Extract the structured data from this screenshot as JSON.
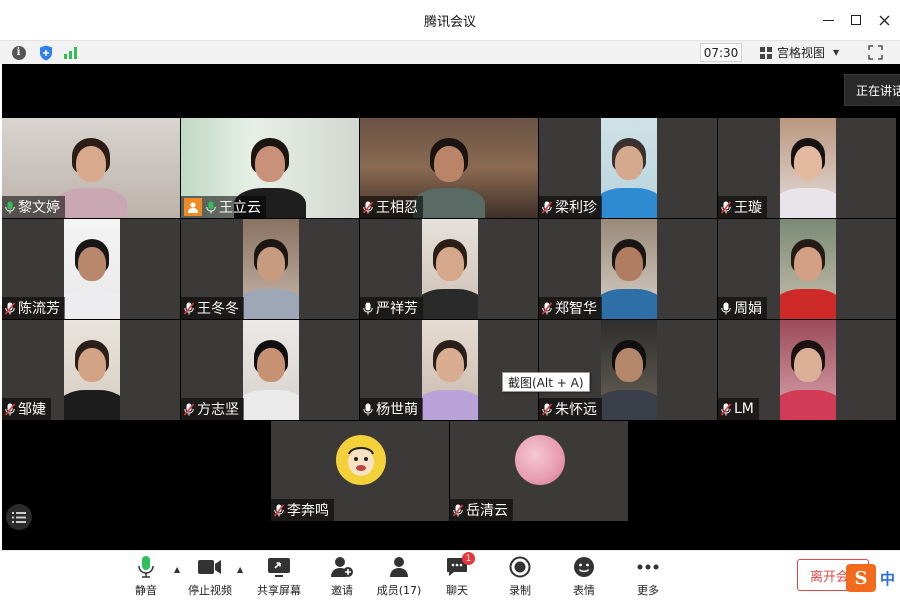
{
  "window": {
    "title": "腾讯会议"
  },
  "toolbar": {
    "timer": "07:30",
    "view_label": "宫格视图"
  },
  "stage": {
    "speaking_label": "正在讲话",
    "tooltip": "截图(Alt + A)",
    "participants": [
      {
        "name": "黎文婷",
        "mic": "on"
      },
      {
        "name": "王立云",
        "mic": "on",
        "host": true,
        "active": true
      },
      {
        "name": "王相忍",
        "mic": "muted"
      },
      {
        "name": "梁利珍",
        "mic": "muted"
      },
      {
        "name": "王璇",
        "mic": "muted"
      },
      {
        "name": "陈流芳",
        "mic": "muted"
      },
      {
        "name": "王冬冬",
        "mic": "muted"
      },
      {
        "name": "严祥芳",
        "mic": "off"
      },
      {
        "name": "郑智华",
        "mic": "muted"
      },
      {
        "name": "周娟",
        "mic": "off"
      },
      {
        "name": "邹婕",
        "mic": "muted"
      },
      {
        "name": "方志坚",
        "mic": "muted"
      },
      {
        "name": "杨世萌",
        "mic": "off"
      },
      {
        "name": "朱怀远",
        "mic": "muted"
      },
      {
        "name": "LM",
        "mic": "muted"
      },
      {
        "name": "李奔鸣",
        "mic": "muted"
      },
      {
        "name": "岳清云",
        "mic": "muted"
      }
    ]
  },
  "bottombar": {
    "mute": "静音",
    "stop_video": "停止视频",
    "share_screen": "共享屏幕",
    "invite": "邀请",
    "members": "成员(17)",
    "chat": "聊天",
    "chat_badge": "1",
    "record": "录制",
    "reactions": "表情",
    "more": "更多",
    "leave": "离开会议"
  },
  "ime": {
    "logo": "S",
    "text": "中"
  },
  "colors": {
    "stage": "#000000",
    "tile": "#3c3a38",
    "active_border": "#4ecf7a",
    "leave": "#e04848",
    "mic_on": "#2fbf5b"
  }
}
